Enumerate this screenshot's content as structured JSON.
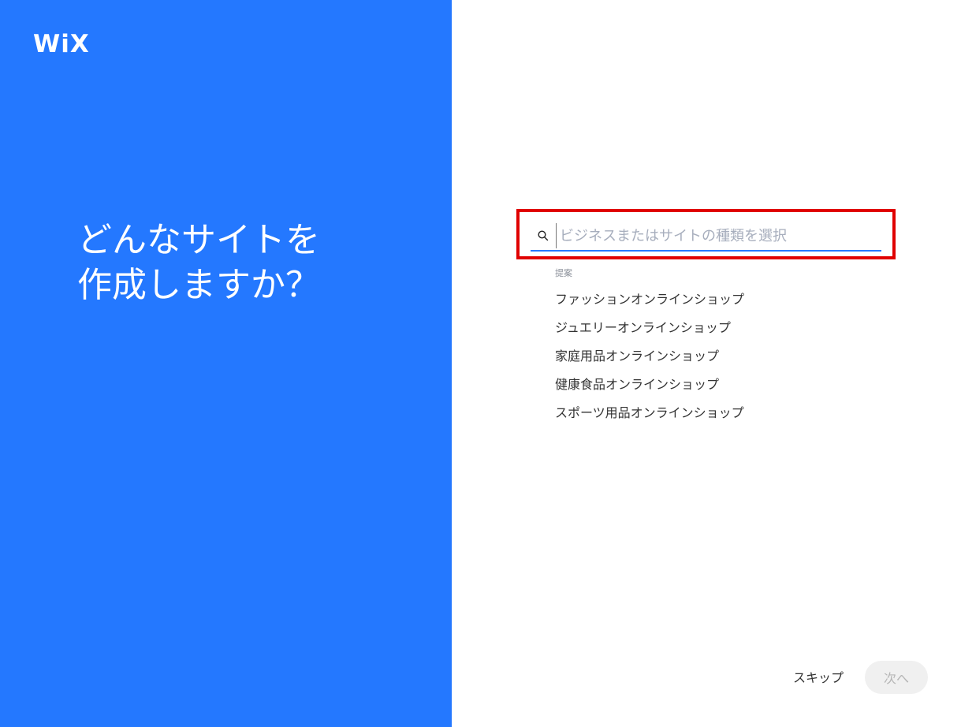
{
  "brand": {
    "logo_text": "WiX",
    "accent_color": "#2478ff"
  },
  "headline": {
    "line1": "どんなサイトを",
    "line2": "作成しますか？"
  },
  "search": {
    "icon": "search-icon",
    "placeholder": "ビジネスまたはサイトの種類を選択",
    "value": ""
  },
  "suggestions": {
    "heading": "提案",
    "items": [
      "ファッションオンラインショップ",
      "ジュエリーオンラインショップ",
      "家庭用品オンラインショップ",
      "健康食品オンラインショップ",
      "スポーツ用品オンラインショップ"
    ]
  },
  "footer": {
    "skip_label": "スキップ",
    "next_label": "次へ"
  },
  "highlight_color": "#e00000"
}
